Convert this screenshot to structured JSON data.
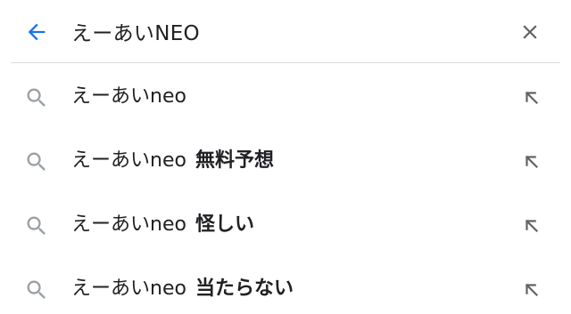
{
  "search": {
    "query": "えーあいNEO",
    "back_icon": "arrow-left-icon",
    "clear_icon": "close-icon",
    "accent_color": "#1a73e8"
  },
  "suggestions": [
    {
      "prefix": "えーあいneo",
      "completion": "",
      "icon": "search-icon",
      "fill_icon": "arrow-up-left-icon"
    },
    {
      "prefix": "えーあいneo",
      "completion": "無料予想",
      "icon": "search-icon",
      "fill_icon": "arrow-up-left-icon"
    },
    {
      "prefix": "えーあいneo",
      "completion": "怪しい",
      "icon": "search-icon",
      "fill_icon": "arrow-up-left-icon"
    },
    {
      "prefix": "えーあいneo",
      "completion": "当たらない",
      "icon": "search-icon",
      "fill_icon": "arrow-up-left-icon"
    }
  ]
}
